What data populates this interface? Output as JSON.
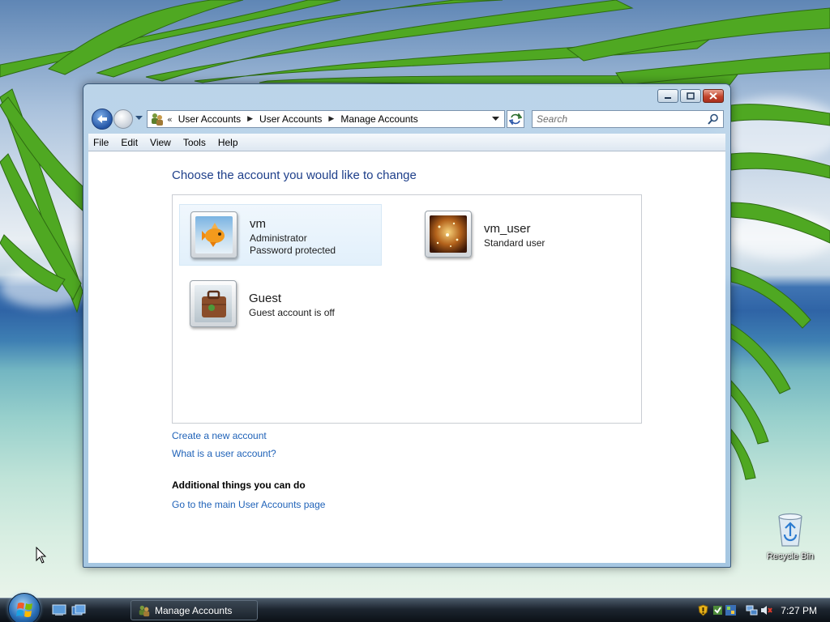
{
  "window": {
    "address_crumbs": [
      "User Accounts",
      "User Accounts",
      "Manage Accounts"
    ],
    "search_placeholder": "Search",
    "menu": [
      "File",
      "Edit",
      "View",
      "Tools",
      "Help"
    ]
  },
  "content": {
    "heading": "Choose the account you would like to change",
    "accounts": [
      {
        "name": "vm",
        "lines": [
          "Administrator",
          "Password protected"
        ],
        "selected": true
      },
      {
        "name": "vm_user",
        "lines": [
          "Standard user"
        ],
        "selected": false
      },
      {
        "name": "Guest",
        "lines": [
          "Guest account is off"
        ],
        "selected": false
      }
    ],
    "links": {
      "create": "Create a new account",
      "what": "What is a user account?"
    },
    "additional_heading": "Additional things you can do",
    "additional_links": [
      "Go to the main User Accounts page"
    ]
  },
  "desktop": {
    "recycle_bin_label": "Recycle Bin"
  },
  "taskbar": {
    "active_window": "Manage Accounts",
    "clock": "7:27 PM"
  },
  "colors": {
    "heading": "#1e3f8a",
    "link": "#1f62b8",
    "selection": "#e2f0fb"
  },
  "icons": [
    "back-arrow-icon",
    "forward-arrow-icon",
    "user-accounts-icon",
    "refresh-icon",
    "search-icon",
    "minimize-icon",
    "maximize-icon",
    "close-icon",
    "recycle-bin-icon",
    "windows-logo-icon",
    "volume-muted-icon",
    "network-icon",
    "security-shield-icon"
  ]
}
